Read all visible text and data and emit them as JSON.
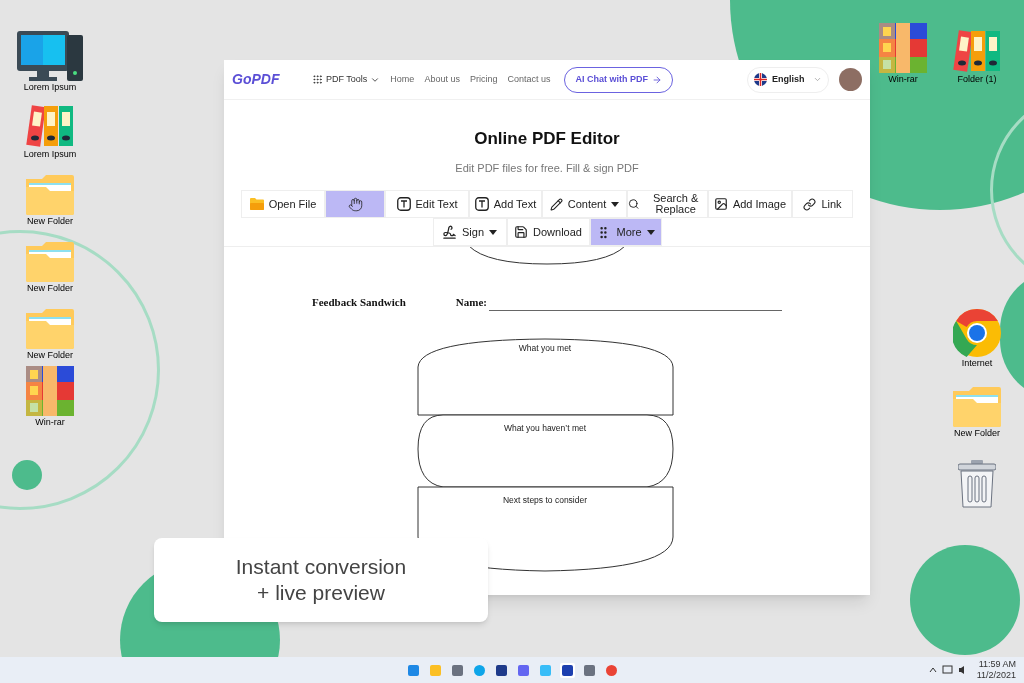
{
  "desktop": {
    "left_icons": [
      {
        "kind": "computer",
        "label": "Lorem Ipsum"
      },
      {
        "kind": "binders",
        "label": "Lorem Ipsum"
      },
      {
        "kind": "folder",
        "label": "New Folder"
      },
      {
        "kind": "folder",
        "label": "New Folder"
      },
      {
        "kind": "folder",
        "label": "New Folder"
      },
      {
        "kind": "winrar",
        "label": "Win-rar"
      }
    ],
    "top_right_icons": [
      {
        "kind": "winrar",
        "label": "Win-rar"
      },
      {
        "kind": "binders",
        "label": "Folder (1)"
      }
    ],
    "right_icons": [
      {
        "kind": "chrome",
        "label": "Internet"
      },
      {
        "kind": "folder",
        "label": "New Folder"
      },
      {
        "kind": "trash"
      }
    ]
  },
  "browser": {
    "nav": {
      "logo": "GoPDF",
      "tools_menu": "PDF Tools",
      "links": [
        "Home",
        "About us",
        "Pricing",
        "Contact us"
      ],
      "cta": "AI Chat with PDF",
      "language": "English"
    },
    "title": "Online PDF Editor",
    "subtitle": "Edit PDF files for free. Fill & sign PDF",
    "toolbar_rows": [
      {
        "items": [
          {
            "label": "Open File",
            "selected": false,
            "dropdown": false
          },
          {
            "selected": true,
            "dropdown": false
          },
          {
            "label": "Edit Text",
            "selected": false,
            "dropdown": false
          },
          {
            "label": "Add Text",
            "selected": false,
            "dropdown": false
          },
          {
            "label": "Content",
            "selected": false,
            "dropdown": true
          },
          {
            "label": "Search & Replace",
            "selected": false,
            "dropdown": false
          },
          {
            "label": "Add Image",
            "selected": false,
            "dropdown": false
          },
          {
            "label": "Link",
            "selected": false,
            "dropdown": false
          }
        ]
      },
      {
        "items": [
          {
            "label": "Sign",
            "selected": false,
            "dropdown": true
          },
          {
            "label": "Download",
            "selected": false,
            "dropdown": false
          },
          {
            "label": "More",
            "selected": true,
            "dropdown": true
          }
        ]
      }
    ],
    "document": {
      "heading": "Feedback Sandwich",
      "name_label": "Name:",
      "sections": [
        "What you met",
        "What you haven’t met",
        "Next steps to consider"
      ]
    }
  },
  "caption": [
    "Instant conversion",
    "+ live preview"
  ],
  "taskbar": {
    "time": "11:59 AM",
    "date": "11/2/2021"
  }
}
